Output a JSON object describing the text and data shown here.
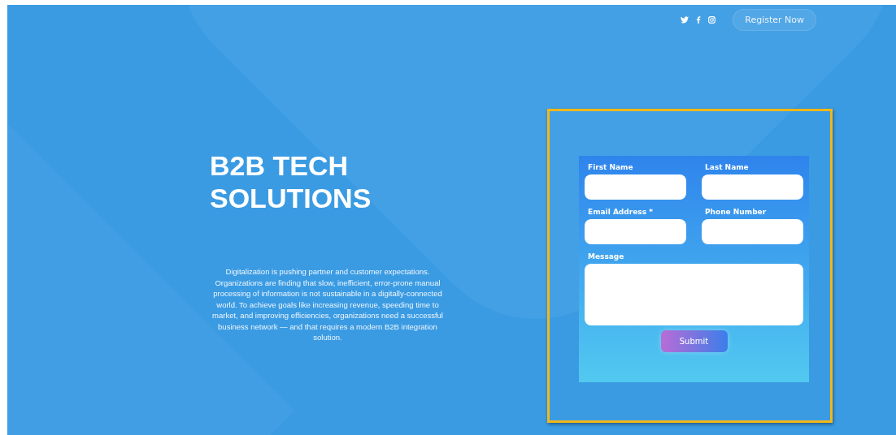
{
  "header": {
    "social_icons": [
      {
        "kind": "twitter"
      },
      {
        "kind": "facebook"
      },
      {
        "kind": "instagram"
      }
    ],
    "register_button": "Register Now"
  },
  "hero": {
    "title": "B2B TECH SOLUTIONS",
    "description": "Digitalization is pushing partner and customer expectations. Organizations are finding that slow, inefficient, error-prone manual processing of information is not sustainable in a digitally-connected world. To achieve goals like increasing revenue, speeding time to market, and improving efficiencies, organizations need a successful business network — and that requires a modern B2B integration solution."
  },
  "form": {
    "fields": [
      {
        "label": "First Name",
        "kind": "input"
      },
      {
        "label": "Last Name",
        "kind": "input"
      },
      {
        "label": "Email Address *",
        "kind": "input"
      },
      {
        "label": "Phone Number",
        "kind": "input"
      },
      {
        "label": "Message",
        "kind": "textarea"
      }
    ],
    "submit": "Submit"
  }
}
